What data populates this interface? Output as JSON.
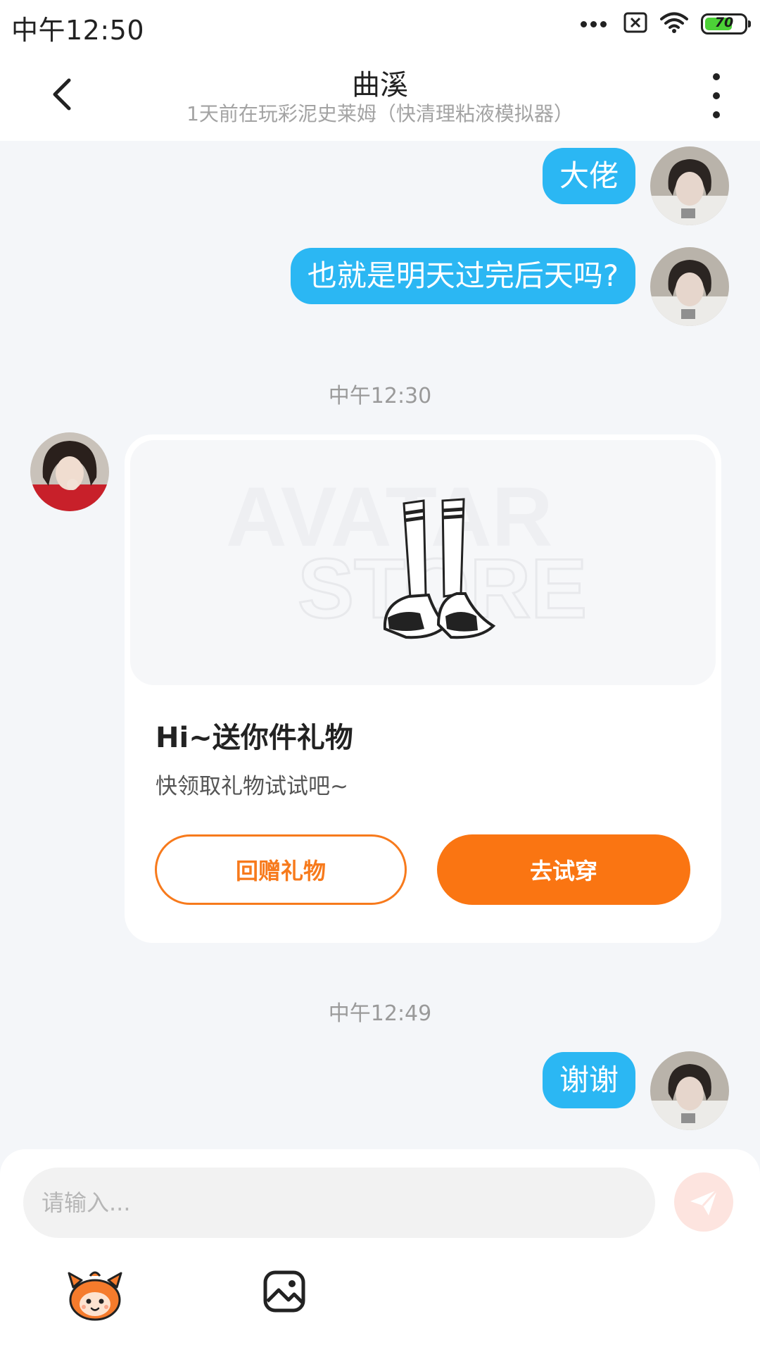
{
  "status_bar": {
    "time": "中午12:50",
    "battery_level": "70",
    "battery_percent": 70
  },
  "header": {
    "title": "曲溪",
    "subtitle": "1天前在玩彩泥史莱姆（快清理粘液模拟器）"
  },
  "messages": {
    "outgoing_1": "大佬",
    "outgoing_2": "也就是明天过完后天吗?",
    "timestamp_1": "中午12:30",
    "gift_card": {
      "watermark_line1": "AVATAR",
      "watermark_line2": "STORE",
      "title": "Hi~送你件礼物",
      "description": "快领取礼物试试吧~",
      "return_gift_label": "回赠礼物",
      "try_on_label": "去试穿"
    },
    "timestamp_2": "中午12:49",
    "outgoing_3": "谢谢"
  },
  "input": {
    "placeholder": "请输入..."
  },
  "icons": {
    "back": "back-arrow-icon",
    "more": "more-vertical-icon",
    "send": "send-icon",
    "emoji": "emoji-mascot-icon",
    "image": "image-icon"
  },
  "colors": {
    "outgoing_bubble": "#2bb7f3",
    "accent_orange": "#fa7512",
    "background": "#f4f6f9"
  }
}
